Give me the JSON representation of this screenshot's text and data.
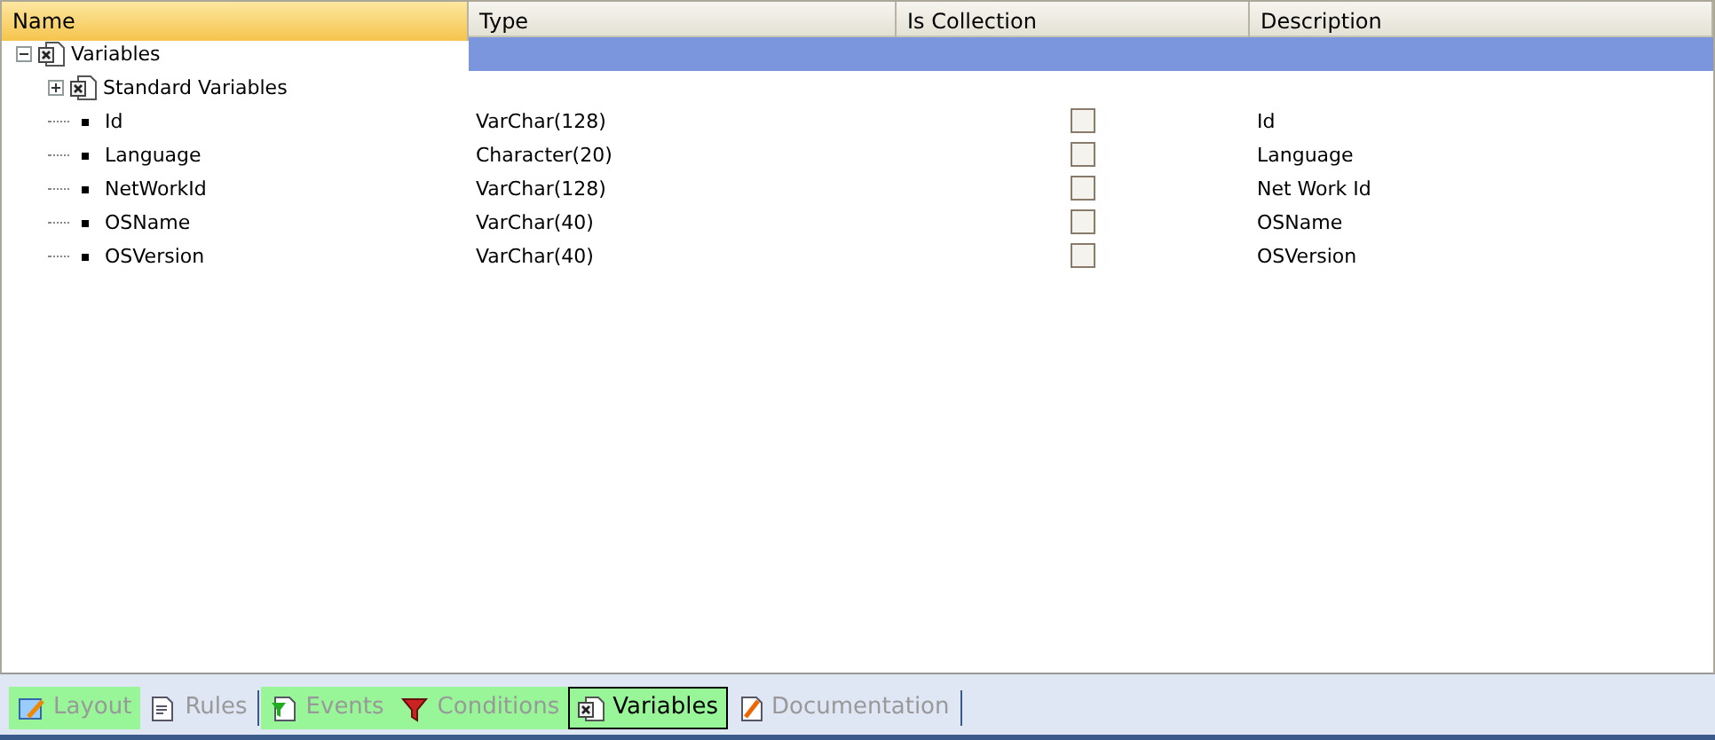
{
  "columns": [
    "Name",
    "Type",
    "Is Collection",
    "Description"
  ],
  "tree": [
    {
      "name": "Variables",
      "kind": "group",
      "expanded": true,
      "selected": true,
      "children": [
        {
          "name": "Standard Variables",
          "kind": "group",
          "expanded": false,
          "selected": false
        },
        {
          "name": "Id",
          "kind": "variable",
          "type": "VarChar(128)",
          "is_collection": false,
          "description": "Id",
          "selected": false
        },
        {
          "name": "Language",
          "kind": "variable",
          "type": "Character(20)",
          "is_collection": false,
          "description": "Language",
          "selected": false
        },
        {
          "name": "NetWorkId",
          "kind": "variable",
          "type": "VarChar(128)",
          "is_collection": false,
          "description": "Net Work Id",
          "selected": false
        },
        {
          "name": "OSName",
          "kind": "variable",
          "type": "VarChar(40)",
          "is_collection": false,
          "description": "OSName",
          "selected": false
        },
        {
          "name": "OSVersion",
          "kind": "variable",
          "type": "VarChar(40)",
          "is_collection": false,
          "description": "OSVersion",
          "selected": false
        }
      ]
    }
  ],
  "tabs": [
    {
      "label": "Layout",
      "kind": "layout",
      "highlighted": true,
      "selected": false
    },
    {
      "label": "Rules",
      "kind": "rules",
      "highlighted": false,
      "selected": false
    },
    {
      "label": "Events",
      "kind": "events",
      "highlighted": true,
      "selected": false
    },
    {
      "label": "Conditions",
      "kind": "conditions",
      "highlighted": true,
      "selected": false
    },
    {
      "label": "Variables",
      "kind": "variables",
      "highlighted": true,
      "selected": true
    },
    {
      "label": "Documentation",
      "kind": "documentation",
      "highlighted": false,
      "selected": false
    }
  ]
}
